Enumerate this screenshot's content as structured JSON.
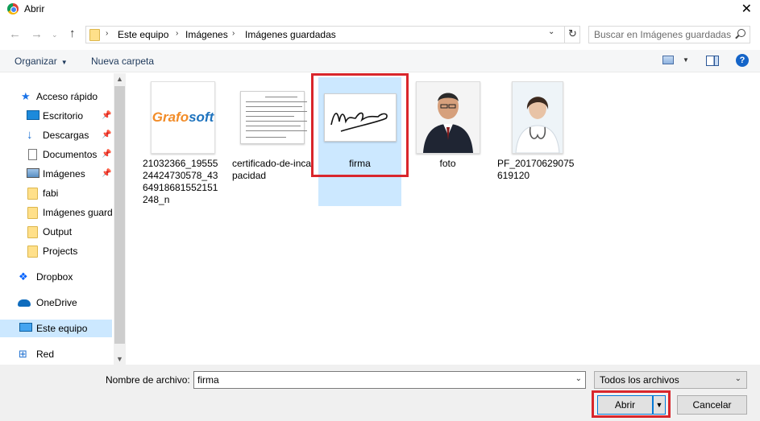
{
  "window": {
    "title": "Abrir",
    "close_label": "✕"
  },
  "address": {
    "breadcrumbs": [
      "Este equipo",
      "Imágenes",
      "Imágenes guardadas"
    ],
    "search_placeholder": "Buscar en Imágenes guardadas"
  },
  "toolbar": {
    "organize_label": "Organizar",
    "new_folder_label": "Nueva carpeta"
  },
  "nav_pane": {
    "items": [
      {
        "label": "Acceso rápido",
        "icon": "star-icon"
      },
      {
        "label": "Escritorio",
        "icon": "desktop-icon",
        "pinned": true
      },
      {
        "label": "Descargas",
        "icon": "download-icon",
        "pinned": true
      },
      {
        "label": "Documentos",
        "icon": "documents-icon",
        "pinned": true
      },
      {
        "label": "Imágenes",
        "icon": "pictures-icon",
        "pinned": true
      },
      {
        "label": "fabi",
        "icon": "folder-icon"
      },
      {
        "label": "Imágenes guard",
        "icon": "folder-icon"
      },
      {
        "label": "Output",
        "icon": "folder-icon"
      },
      {
        "label": "Projects",
        "icon": "folder-icon"
      },
      {
        "label": "Dropbox",
        "icon": "dropbox-icon"
      },
      {
        "label": "OneDrive",
        "icon": "onedrive-icon"
      },
      {
        "label": "Este equipo",
        "icon": "computer-icon",
        "selected": true
      },
      {
        "label": "Red",
        "icon": "network-icon"
      }
    ]
  },
  "files": [
    {
      "name": "21032366_1955524424730578_4364918681552151248_n",
      "thumb": "grafosoft",
      "logo_text_1": "Grafo",
      "logo_text_2": "soft"
    },
    {
      "name": "certificado-de-incapacidad",
      "thumb": "certificate"
    },
    {
      "name": "firma",
      "thumb": "signature",
      "selected": true
    },
    {
      "name": "foto",
      "thumb": "man-photo"
    },
    {
      "name": "PF_20170629075619120",
      "thumb": "doctor-photo"
    }
  ],
  "bottom": {
    "file_name_label": "Nombre de archivo:",
    "file_name_value": "firma",
    "file_type_value": "Todos los archivos",
    "open_label": "Abrir",
    "cancel_label": "Cancelar"
  },
  "colors": {
    "selection": "#cce8ff",
    "highlight_outline": "#d9262c",
    "accent": "#0078d7"
  }
}
